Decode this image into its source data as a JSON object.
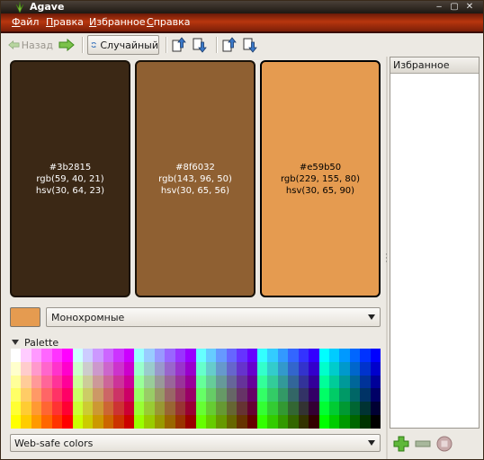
{
  "window": {
    "title": "Agave",
    "controls": [
      "minimize-icon",
      "maximize-icon",
      "close-icon"
    ]
  },
  "menu": [
    {
      "label": "Файл",
      "mnemonic": "Ф",
      "rest": "айл"
    },
    {
      "label": "Правка",
      "mnemonic": "П",
      "rest": "равка"
    },
    {
      "label": "Избранное",
      "mnemonic": "И",
      "rest": "збранное"
    },
    {
      "label": "Справка",
      "mnemonic": "С",
      "rest": "правка"
    }
  ],
  "toolbar": {
    "back_label": "Назад",
    "random_label": "Случайный",
    "icons": [
      "arrow-left-icon",
      "arrow-right-icon",
      "refresh-icon",
      "lighten-icon",
      "darken-icon",
      "saturate-icon",
      "desaturate-icon"
    ]
  },
  "colors": [
    {
      "hex": "#3b2815",
      "rgb": "rgb(59, 40, 21)",
      "hsv": "hsv(30, 64, 23)"
    },
    {
      "hex": "#8f6032",
      "rgb": "rgb(143, 96, 50)",
      "hsv": "hsv(30, 65, 56)"
    },
    {
      "hex": "#e59b50",
      "rgb": "rgb(229, 155, 80)",
      "hsv": "hsv(30, 65, 90)"
    }
  ],
  "scheme": {
    "current_color": "#e59b50",
    "selected": "Монохромные"
  },
  "palette": {
    "label": "Palette",
    "selected": "Web-safe colors"
  },
  "favorites": {
    "header": "Избранное",
    "buttons": [
      "add-icon",
      "remove-icon",
      "clear-icon"
    ]
  },
  "theme": {
    "menubar_color": "#a8300c",
    "accent": "#e59b50"
  }
}
